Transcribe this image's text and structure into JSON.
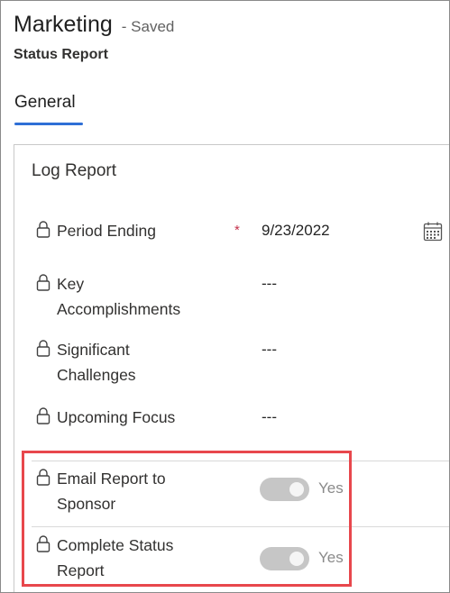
{
  "header": {
    "record_title": "Marketing",
    "saved_status": "- Saved",
    "entity_type": "Status Report"
  },
  "tabs": [
    {
      "label": "General",
      "selected": true
    }
  ],
  "section": {
    "title": "Log Report",
    "fields": [
      {
        "label": "Period Ending",
        "value": "9/23/2022",
        "required": true,
        "locked": true
      },
      {
        "label": "Key Accomplishments",
        "value": "---",
        "locked": true
      },
      {
        "label": "Significant Challenges",
        "value": "---",
        "locked": true
      },
      {
        "label": "Upcoming Focus",
        "value": "---",
        "locked": true
      },
      {
        "label": "Email Report to Sponsor",
        "value": "Yes",
        "toggle_on": true,
        "locked": true
      },
      {
        "label": "Complete Status Report",
        "value": "Yes",
        "toggle_on": true,
        "locked": true
      }
    ],
    "required_marker": "*"
  },
  "icons": {
    "lock": "lock-icon",
    "calendar": "calendar-icon"
  },
  "colors": {
    "accent": "#2f6fd6",
    "required": "#c4314b",
    "highlight": "#e8474c",
    "toggle_disabled": "#c6c6c6"
  }
}
